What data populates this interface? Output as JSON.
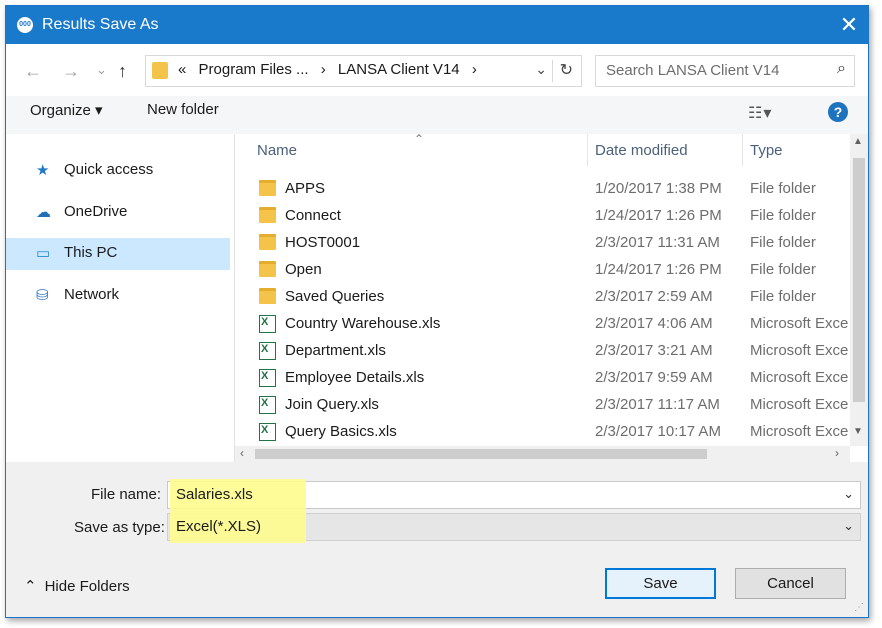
{
  "window": {
    "title": "Results Save As",
    "close": "✕"
  },
  "nav": {
    "back": "←",
    "forward": "→",
    "dropdown": "⌄",
    "up": "↑",
    "crumbs": [
      "«",
      "Program Files ...",
      "›",
      "LANSA Client V14",
      "›"
    ],
    "search_placeholder": "Search LANSA Client V14"
  },
  "toolbar": {
    "organize": "Organize ▾",
    "new_folder": "New folder",
    "view": "☷▾",
    "help": "?"
  },
  "sidebar": {
    "items": [
      {
        "label": "Quick access",
        "icon": "star-icon",
        "glyph": "★",
        "color": "#1f78c8"
      },
      {
        "label": "OneDrive",
        "icon": "cloud-icon",
        "glyph": "☁",
        "color": "#1f6fb5"
      },
      {
        "label": "This PC",
        "icon": "monitor-icon",
        "glyph": "▭",
        "color": "#2a8ad4"
      },
      {
        "label": "Network",
        "icon": "network-icon",
        "glyph": "⛁",
        "color": "#2a7ac2"
      }
    ]
  },
  "columns": {
    "name": "Name",
    "date": "Date modified",
    "type": "Type"
  },
  "files": [
    {
      "name": "APPS",
      "date": "1/20/2017 1:38 PM",
      "type": "File folder",
      "kind": "folder"
    },
    {
      "name": "Connect",
      "date": "1/24/2017 1:26 PM",
      "type": "File folder",
      "kind": "folder"
    },
    {
      "name": "HOST0001",
      "date": "2/3/2017 11:31 AM",
      "type": "File folder",
      "kind": "folder"
    },
    {
      "name": "Open",
      "date": "1/24/2017 1:26 PM",
      "type": "File folder",
      "kind": "folder"
    },
    {
      "name": "Saved Queries",
      "date": "2/3/2017 2:59 AM",
      "type": "File folder",
      "kind": "folder"
    },
    {
      "name": "Country Warehouse.xls",
      "date": "2/3/2017 4:06 AM",
      "type": "Microsoft Exce",
      "kind": "xls"
    },
    {
      "name": "Department.xls",
      "date": "2/3/2017 3:21 AM",
      "type": "Microsoft Exce",
      "kind": "xls"
    },
    {
      "name": "Employee Details.xls",
      "date": "2/3/2017 9:59 AM",
      "type": "Microsoft Exce",
      "kind": "xls"
    },
    {
      "name": "Join Query.xls",
      "date": "2/3/2017 11:17 AM",
      "type": "Microsoft Exce",
      "kind": "xls"
    },
    {
      "name": "Query Basics.xls",
      "date": "2/3/2017 10:17 AM",
      "type": "Microsoft Exce",
      "kind": "xls"
    }
  ],
  "form": {
    "file_name_label": "File name:",
    "file_name_value": "Salaries.xls",
    "save_type_label": "Save as type:",
    "save_type_value": "Excel(*.XLS)",
    "highlight_color": "#fefb8e"
  },
  "footer": {
    "hide_folders": "Hide Folders",
    "save": "Save",
    "cancel": "Cancel"
  },
  "colors": {
    "title_bar": "#1979ca",
    "selection": "#cce8ff",
    "accent": "#0078d7"
  }
}
